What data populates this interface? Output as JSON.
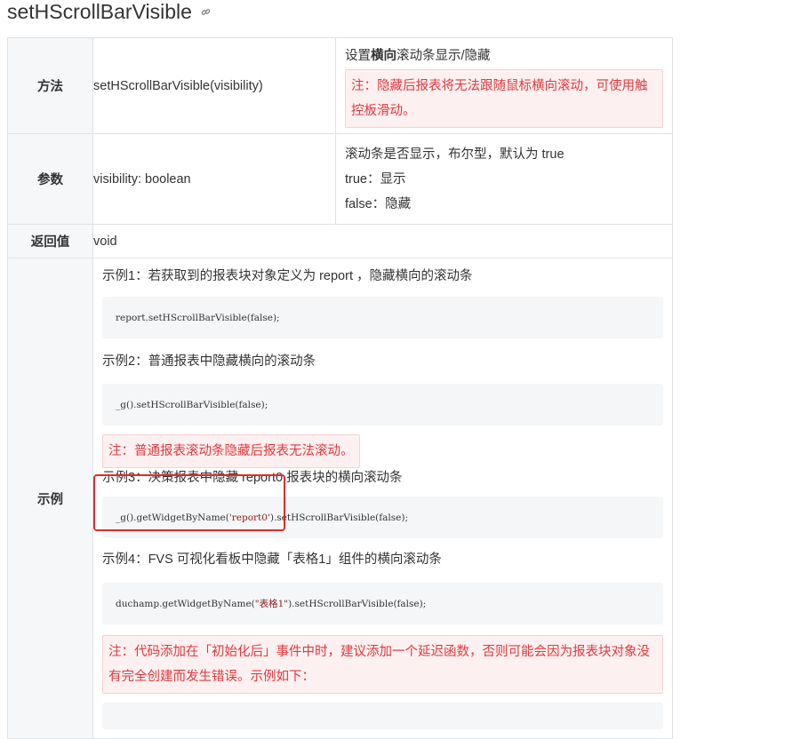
{
  "title": "setHScrollBarVisible",
  "rows": {
    "method": {
      "header": "方法",
      "value": "setHScrollBarVisible(visibility)",
      "desc_prefix": "设置",
      "desc_bold": "横向",
      "desc_suffix": "滚动条显示/隐藏",
      "note": "注：隐藏后报表将无法跟随鼠标横向滚动，可使用触控板滑动。"
    },
    "param": {
      "header": "参数",
      "value": "visibility: boolean",
      "lines": [
        "滚动条是否显示，布尔型，默认为 true",
        "true：显示",
        "false：隐藏"
      ]
    },
    "ret": {
      "header": "返回值",
      "value": "void"
    },
    "example": {
      "header": "示例",
      "ex1_label": "示例1：若获取到的报表块对象定义为 report ，隐藏横向的滚动条",
      "ex1_code": "report.setHScrollBarVisible(false);",
      "ex2_label": "示例2：普通报表中隐藏横向的滚动条",
      "ex2_code": "_g().setHScrollBarVisible(false);",
      "ex2_note": "注：普通报表滚动条隐藏后报表无法滚动。",
      "ex3_label": "示例3：决策报表中隐藏 report0 报表块的横向滚动条",
      "ex3_code_a": "_g().getWidgetByName(",
      "ex3_code_str": "'report0'",
      "ex3_code_b": ").setHScrollBarVisible(false);",
      "ex4_label": "示例4：FVS 可视化看板中隐藏「表格1」组件的横向滚动条",
      "ex4_code_a": "duchamp.getWidgetByName(",
      "ex4_code_str": "\"表格1\"",
      "ex4_code_b": ").setHScrollBarVisible(false);",
      "final_note": "注：代码添加在「初始化后」事件中时，建议添加一个延迟函数，否则可能会因为报表块对象没有完全创建而发生错误。示例如下："
    }
  }
}
